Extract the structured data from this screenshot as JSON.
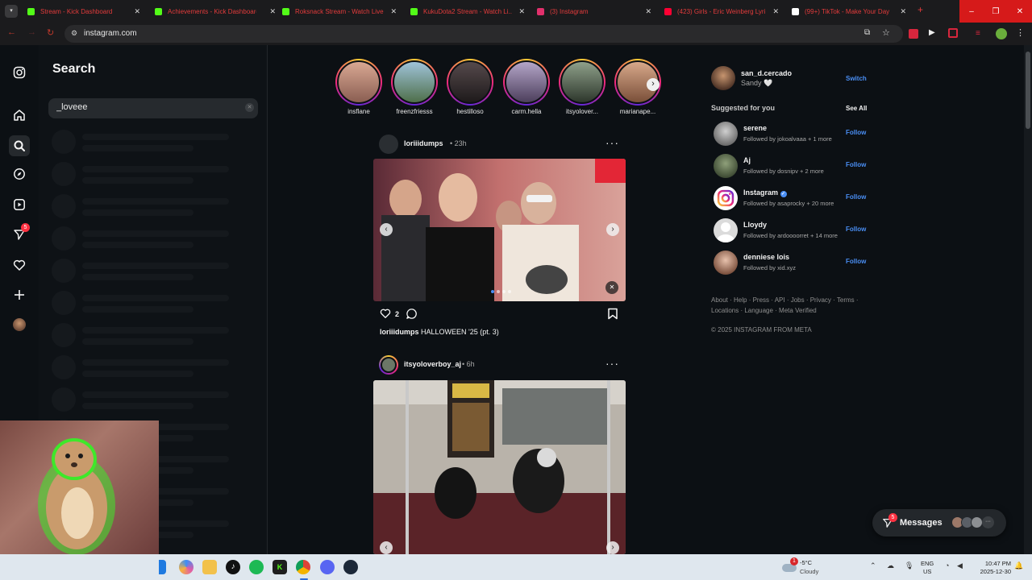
{
  "browser": {
    "tabs": [
      {
        "title": "Stream - Kick Dashboard",
        "favicon": "kick-icon",
        "color": "#53fc18"
      },
      {
        "title": "Achievements - Kick Dashboard",
        "favicon": "kick-icon",
        "color": "#53fc18"
      },
      {
        "title": "Roksnack Stream - Watch Live",
        "favicon": "kick-icon",
        "color": "#53fc18"
      },
      {
        "title": "KukuDota2 Stream - Watch Li...",
        "favicon": "kick-icon",
        "color": "#53fc18"
      },
      {
        "title": "(3) Instagram",
        "favicon": "instagram-icon",
        "color": "#e1306c"
      },
      {
        "title": "(423) Girls - Eric Weinberg Lyri...",
        "favicon": "youtube-icon",
        "color": "#ff0033"
      },
      {
        "title": "(99+) TikTok - Make Your Day",
        "favicon": "tiktok-icon",
        "color": "#ffffff"
      }
    ],
    "url": "instagram.com"
  },
  "sidebar": {
    "items": [
      {
        "name": "instagram-logo-icon"
      },
      {
        "name": "home-icon"
      },
      {
        "name": "search-icon"
      },
      {
        "name": "explore-icon"
      },
      {
        "name": "reels-icon"
      },
      {
        "name": "messages-nav-icon",
        "badge": "5"
      },
      {
        "name": "notifications-icon"
      },
      {
        "name": "create-icon"
      },
      {
        "name": "profile-avatar"
      }
    ]
  },
  "search": {
    "title": "Search",
    "query": "_loveee"
  },
  "stories": [
    {
      "name": "insflane",
      "color": "#c98f79"
    },
    {
      "name": "freenzfriesss",
      "color": "#6f8f76"
    },
    {
      "name": "hestilloso",
      "color": "#40383a"
    },
    {
      "name": "carm.hella",
      "color": "#8a7d9c"
    },
    {
      "name": "itsyolover...",
      "color": "#687565"
    },
    {
      "name": "marianape...",
      "color": "#b07c63"
    }
  ],
  "posts": [
    {
      "user": "loriiidumps",
      "time": "23h",
      "likes": "2",
      "caption_user": "loriiidumps",
      "caption": "HALLOWEEN '25 (pt. 3)"
    },
    {
      "user": "itsyoloverboy_aj",
      "time": "6h"
    }
  ],
  "account": {
    "username": "san_d.cercado",
    "name": "Sandy 🤍",
    "switch": "Switch"
  },
  "suggested": {
    "title": "Suggested for you",
    "see_all": "See All",
    "items": [
      {
        "name": "serene",
        "sub": "Followed by jokoalvaaa + 1 more",
        "follow": "Follow",
        "color": "#8b8b8b"
      },
      {
        "name": "Aj",
        "sub": "Followed by dosnipv + 2 more",
        "follow": "Follow",
        "color": "#6d7a5f"
      },
      {
        "name": "Instagram",
        "verified": true,
        "sub": "Followed by asaprocky + 20 more",
        "follow": "Follow",
        "color": "#d6249f"
      },
      {
        "name": "Lloydy",
        "sub": "Followed by ardoooorret + 14 more",
        "follow": "Follow",
        "color": "#dbdbdb"
      },
      {
        "name": "denniese lois",
        "sub": "Followed by xid.xyz",
        "follow": "Follow",
        "color": "#c4a28e"
      }
    ]
  },
  "footer": {
    "links_line1": "About · Help · Press · API · Jobs · Privacy · Terms ·",
    "links_line2": "Locations · Language · Meta Verified",
    "copyright": "© 2025 INSTAGRAM FROM META"
  },
  "messages": {
    "label": "Messages",
    "badge": "5"
  },
  "taskbar": {
    "weather_temp": "-5°C",
    "weather_desc": "Cloudy",
    "weather_badge": "1",
    "lang_top": "ENG",
    "lang_bottom": "US",
    "time": "10:47 PM",
    "date": "2025-12-30"
  }
}
